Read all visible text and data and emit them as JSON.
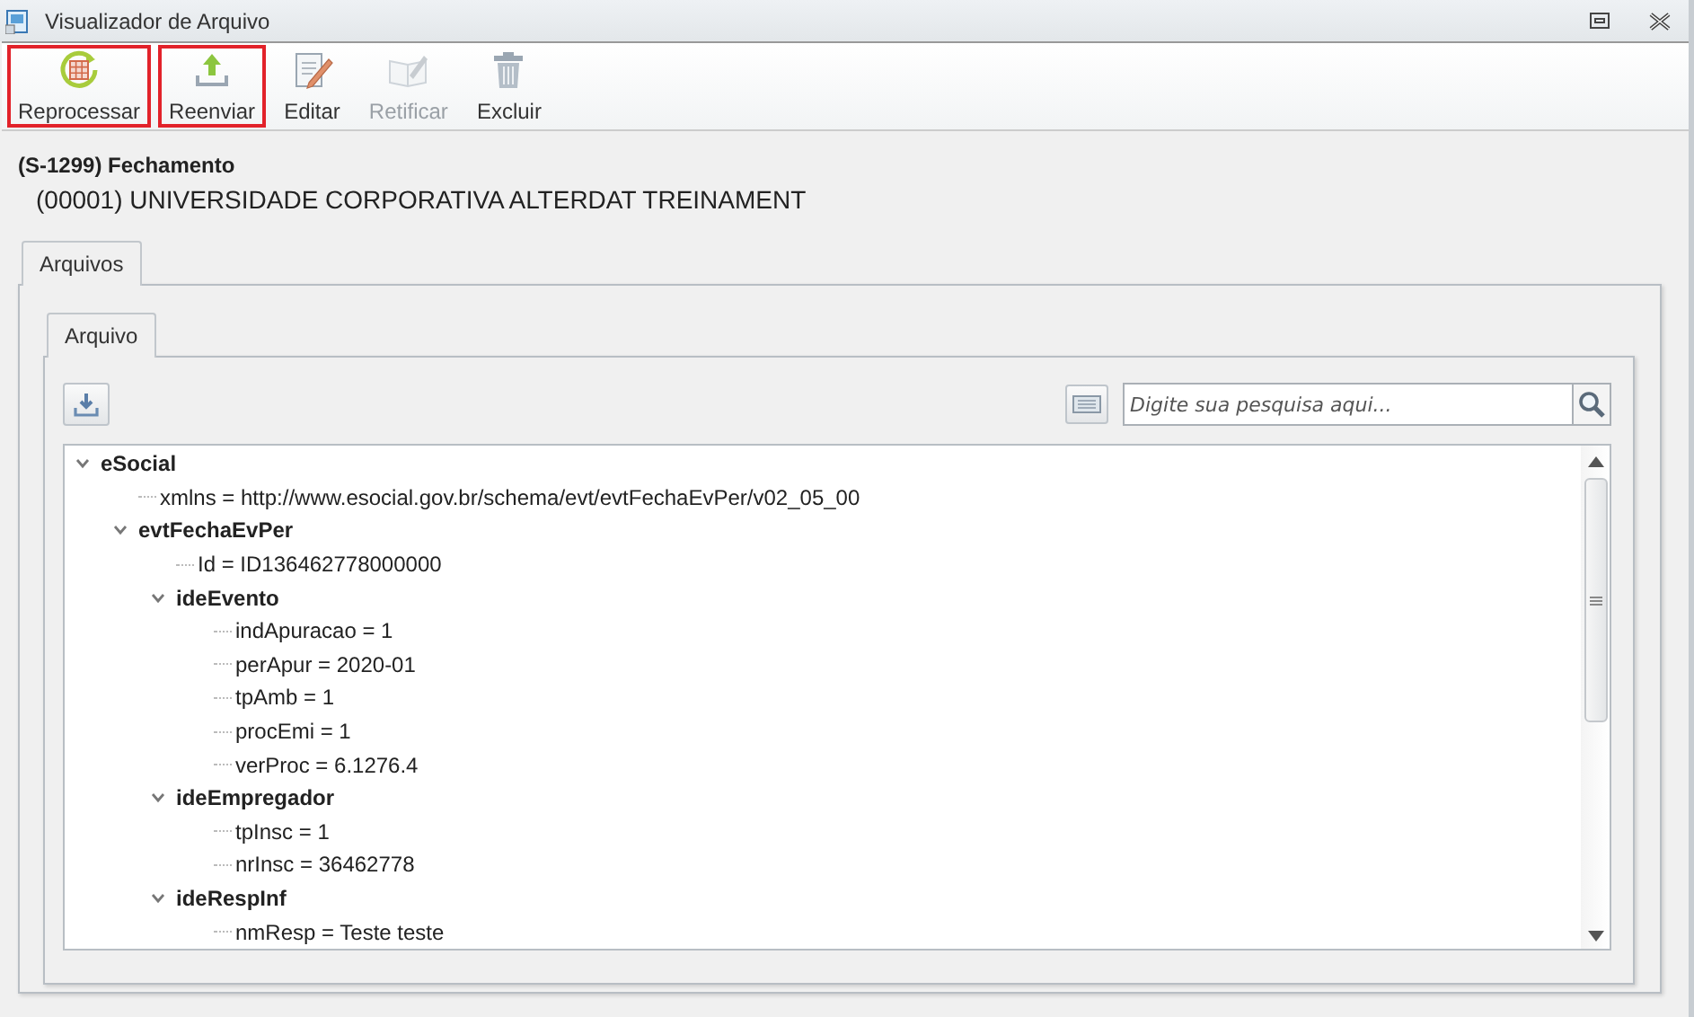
{
  "window": {
    "title": "Visualizador de Arquivo"
  },
  "toolbar": [
    {
      "label": "Reprocessar",
      "kind": "reprocess",
      "disabled": false,
      "highlighted": true
    },
    {
      "label": "Reenviar",
      "kind": "upload",
      "disabled": false,
      "highlighted": true
    },
    {
      "label": "Editar",
      "kind": "edit",
      "disabled": false,
      "highlighted": false
    },
    {
      "label": "Retificar",
      "kind": "rectify",
      "disabled": true,
      "highlighted": false
    },
    {
      "label": "Excluir",
      "kind": "delete",
      "disabled": false,
      "highlighted": false
    }
  ],
  "header": {
    "event": "(S-1299) Fechamento",
    "company": "(00001) UNIVERSIDADE CORPORATIVA ALTERDAT TREINAMENT"
  },
  "outer_tabs": [
    {
      "label": "Arquivos",
      "selected": true
    }
  ],
  "inner_tabs": [
    {
      "label": "Arquivo",
      "selected": true
    }
  ],
  "search": {
    "placeholder": "Digite sua pesquisa aqui..."
  },
  "tree": [
    {
      "label": "eSocial",
      "kind": "element",
      "expanded": true,
      "children": [
        {
          "label": "xmlns = http://www.esocial.gov.br/schema/evt/evtFechaEvPer/v02_05_00",
          "kind": "attribute"
        },
        {
          "label": "evtFechaEvPer",
          "kind": "element",
          "expanded": true,
          "children": [
            {
              "label": "Id = ID136462778000000",
              "kind": "attribute"
            },
            {
              "label": "ideEvento",
              "kind": "element",
              "expanded": true,
              "children": [
                {
                  "label": "indApuracao = 1",
                  "kind": "attribute"
                },
                {
                  "label": "perApur = 2020-01",
                  "kind": "attribute"
                },
                {
                  "label": "tpAmb = 1",
                  "kind": "attribute"
                },
                {
                  "label": "procEmi = 1",
                  "kind": "attribute"
                },
                {
                  "label": "verProc = 6.1276.4",
                  "kind": "attribute"
                }
              ]
            },
            {
              "label": "ideEmpregador",
              "kind": "element",
              "expanded": true,
              "children": [
                {
                  "label": "tpInsc = 1",
                  "kind": "attribute"
                },
                {
                  "label": "nrInsc = 36462778",
                  "kind": "attribute"
                }
              ]
            },
            {
              "label": "ideRespInf",
              "kind": "element",
              "expanded": true,
              "children": [
                {
                  "label": "nmResp = Teste teste",
                  "kind": "attribute"
                }
              ]
            }
          ]
        }
      ]
    }
  ]
}
